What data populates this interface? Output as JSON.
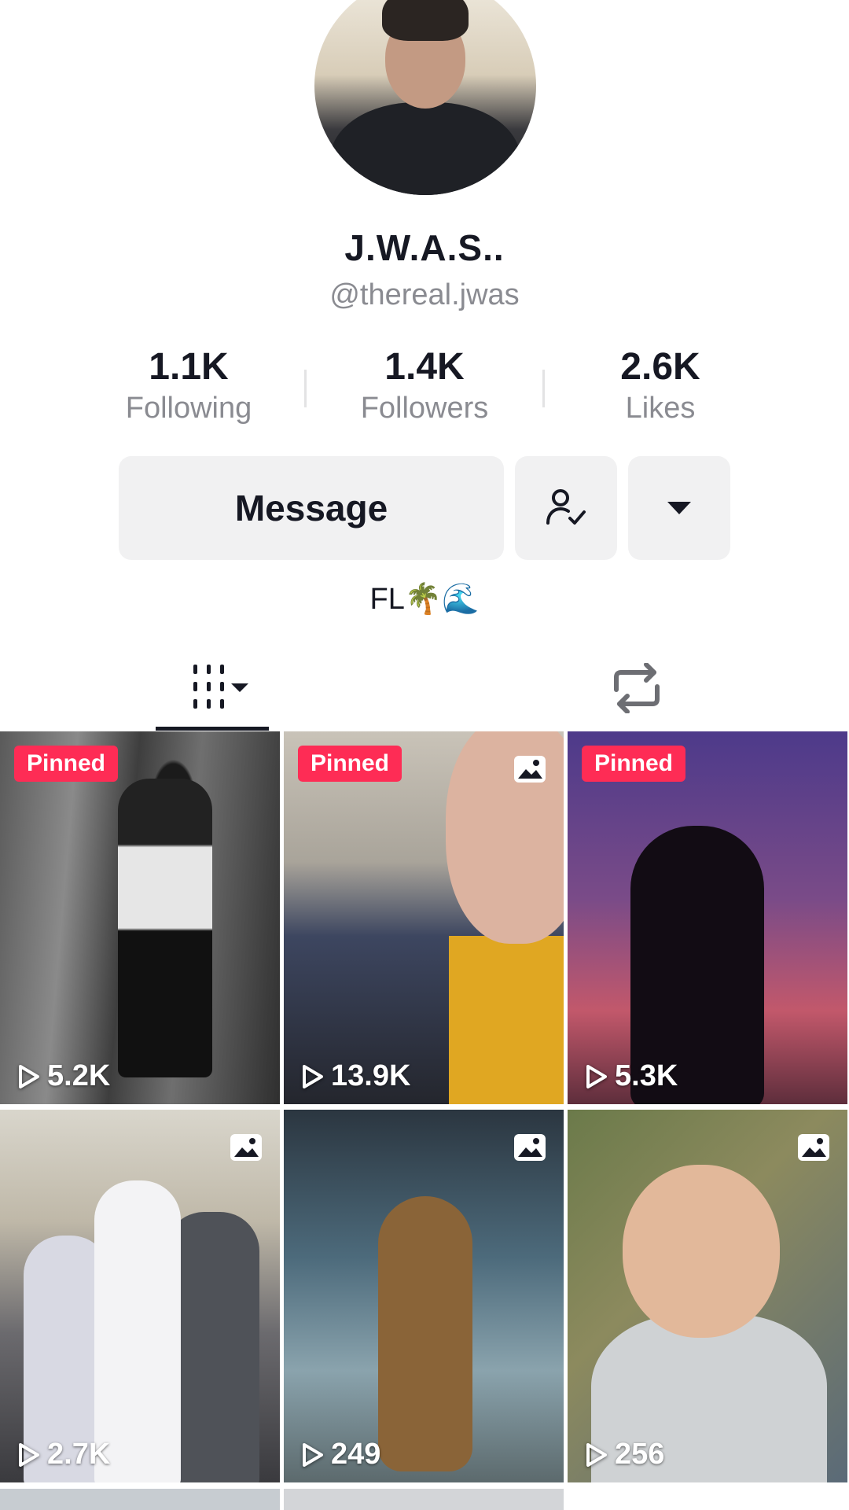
{
  "profile": {
    "display_name": "J.W.A.S..",
    "handle": "@thereal.jwas",
    "bio": "FL🌴🌊"
  },
  "stats": [
    {
      "value": "1.1K",
      "label": "Following"
    },
    {
      "value": "1.4K",
      "label": "Followers"
    },
    {
      "value": "2.6K",
      "label": "Likes"
    }
  ],
  "actions": {
    "message_label": "Message",
    "follow_icon": "user-check-icon",
    "more_icon": "caret-down-icon"
  },
  "tabs": [
    {
      "icon": "videos-grid-icon",
      "active": true
    },
    {
      "icon": "repost-icon",
      "active": false
    }
  ],
  "videos": [
    {
      "pinned_label": "Pinned",
      "views": "5.2K",
      "is_photo": false
    },
    {
      "pinned_label": "Pinned",
      "views": "13.9K",
      "is_photo": true
    },
    {
      "pinned_label": "Pinned",
      "views": "5.3K",
      "is_photo": false
    },
    {
      "pinned_label": "",
      "views": "2.7K",
      "is_photo": true
    },
    {
      "pinned_label": "",
      "views": "249",
      "is_photo": true
    },
    {
      "pinned_label": "",
      "views": "256",
      "is_photo": true
    }
  ],
  "colors": {
    "pinned_badge": "#fe2c55",
    "button_bg": "#f1f1f2",
    "secondary_text": "#8a8b91"
  }
}
